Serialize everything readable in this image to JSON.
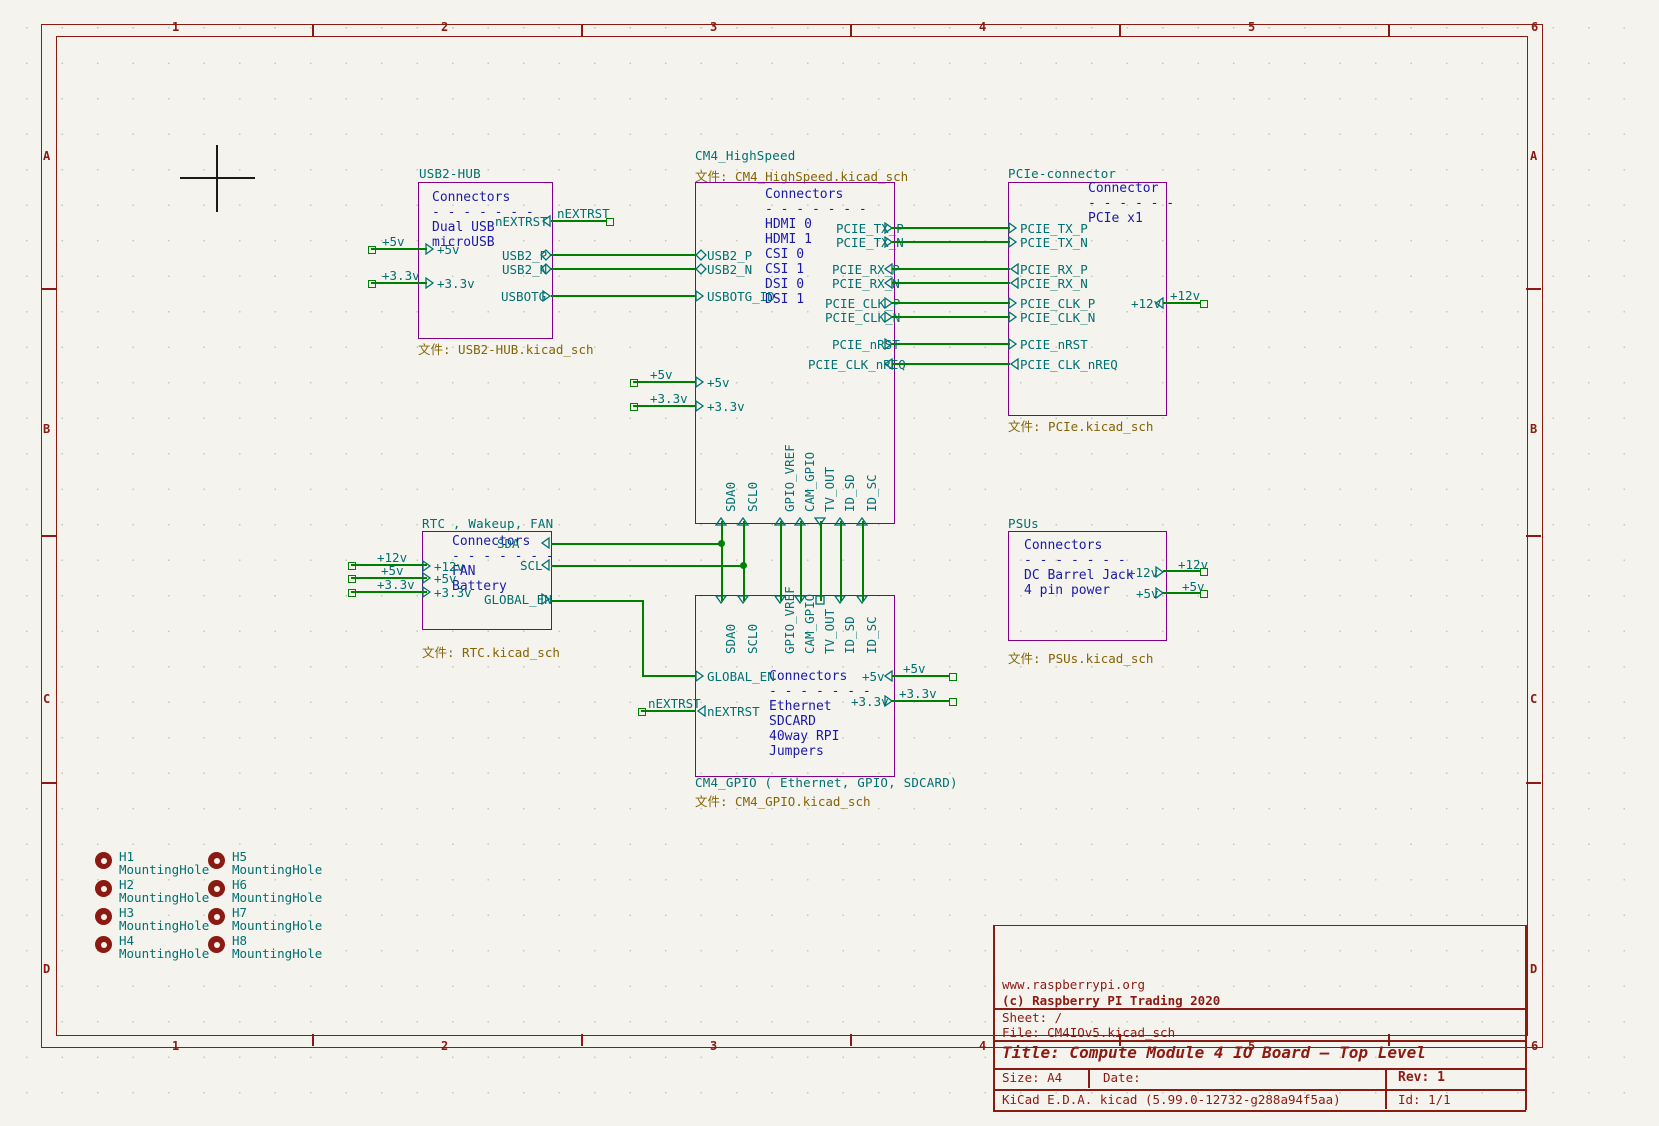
{
  "app": {
    "kind": "kicad-schematic-editor",
    "sheet_size": "A4"
  },
  "frame": {
    "column_labels": [
      "1",
      "2",
      "3",
      "4",
      "5",
      "6"
    ],
    "row_labels": [
      "A",
      "B",
      "C",
      "D"
    ]
  },
  "title_block": {
    "website": "www.raspberrypi.org",
    "copyright": "(c) Raspberry PI Trading 2020",
    "sheet_label": "Sheet: /",
    "file_label": "File: CM4IOv5.kicad_sch",
    "title": "Title: Compute Module 4 IO Board — Top Level",
    "size": "Size: A4",
    "date": "Date:",
    "rev": "Rev: 1",
    "tool": "KiCad E.D.A.  kicad (5.99.0-12732-g288a94f5aa)",
    "id": "Id: 1/1"
  },
  "sheets": [
    {
      "id": "usb2-hub",
      "name": "USB2-HUB",
      "file": "文件: USB2-HUB.kicad_sch",
      "body": "Connectors\n- - - - - - -\nDual USB\nmicroUSB",
      "pins_left": [
        "+5v",
        "+3.3v"
      ],
      "pins_right": [
        "nEXTRST",
        "USB2_P",
        "USB2_N",
        "USBOTG"
      ]
    },
    {
      "id": "cm4-highspeed",
      "name": "CM4_HighSpeed",
      "file": "文件: CM4_HighSpeed.kicad_sch",
      "body": "Connectors\n- - - - - - -\nHDMI 0\nHDMI 1\nCSI 0\nCSI 1\nDSI 0\nDSI 1",
      "pins_left": [
        "USB2_P",
        "USB2_N",
        "USBOTG_ID",
        "+5v",
        "+3.3v"
      ],
      "pins_right": [
        "PCIE_TX_P",
        "PCIE_TX_N",
        "PCIE_RX_P",
        "PCIE_RX_N",
        "PCIE_CLK_P",
        "PCIE_CLK_N",
        "PCIE_nRST",
        "PCIE_CLK_nREQ"
      ],
      "pins_bottom": [
        "SDA0",
        "SCL0",
        "GPIO_VREF",
        "CAM_GPIO",
        "TV_OUT",
        "ID_SD",
        "ID_SC"
      ]
    },
    {
      "id": "pcie-connector",
      "name": "PCIe-connector",
      "file": "文件: PCIe.kicad_sch",
      "body": "Connector\n- - - - - -\nPCIe x1",
      "pins_left": [
        "PCIE_TX_P",
        "PCIE_TX_N",
        "PCIE_RX_P",
        "PCIE_RX_N",
        "PCIE_CLK_P",
        "PCIE_CLK_N",
        "PCIE_nRST",
        "PCIE_CLK_nREQ"
      ],
      "pins_right": [
        "+12v"
      ]
    },
    {
      "id": "rtc-wakeup-fan",
      "name": "RTC , Wakeup, FAN",
      "file": "文件: RTC.kicad_sch",
      "body": "Connectors\n- - - - - - -\nFAN\nBattery",
      "pins_left": [
        "+12v",
        "+5v",
        "+3.3v"
      ],
      "pins_right": [
        "SDA",
        "SCL",
        "GLOBAL_EN"
      ]
    },
    {
      "id": "psus",
      "name": "PSUs",
      "file": "文件: PSUs.kicad_sch",
      "body": "Connectors\n- - - - - - -\nDC Barrel Jack\n4 pin power",
      "pins_right": [
        "+12v",
        "+5v"
      ]
    },
    {
      "id": "cm4-gpio",
      "name": "CM4_GPIO ( Ethernet, GPIO, SDCARD)",
      "file": "文件: CM4_GPIO.kicad_sch",
      "body": "Connectors\n- - - - - - -\nEthernet\nSDCARD\n40way RPI\nJumpers",
      "pins_top": [
        "SDA0",
        "SCL0",
        "GPIO_VREF",
        "CAM_GPIO",
        "TV_OUT",
        "ID_SD",
        "ID_SC"
      ],
      "pins_left": [
        "GLOBAL_EN",
        "nEXTRST"
      ],
      "pins_right": [
        "+5v",
        "+3.3v"
      ]
    }
  ],
  "net_labels": [
    {
      "text": "nEXTRST",
      "where": "usb2-hub-right"
    },
    {
      "text": "nEXTRST",
      "where": "cm4-gpio-left"
    },
    {
      "text": "+5v",
      "where": "usb2-hub-in"
    },
    {
      "text": "+3.3v",
      "where": "usb2-hub-in"
    },
    {
      "text": "+5v",
      "where": "cm4-hs-in"
    },
    {
      "text": "+3.3v",
      "where": "cm4-hs-in"
    },
    {
      "text": "+12v",
      "where": "rtc-in"
    },
    {
      "text": "+5v",
      "where": "rtc-in"
    },
    {
      "text": "+3.3v",
      "where": "rtc-in"
    },
    {
      "text": "+12v",
      "where": "pcie-out"
    },
    {
      "text": "+12v",
      "where": "psus-out"
    },
    {
      "text": "+5v",
      "where": "psus-out"
    },
    {
      "text": "+5v",
      "where": "cm4-gpio-out"
    },
    {
      "text": "+3.3v",
      "where": "cm4-gpio-out"
    }
  ],
  "mounting_holes": [
    {
      "ref": "H1",
      "value": "MountingHole"
    },
    {
      "ref": "H2",
      "value": "MountingHole"
    },
    {
      "ref": "H3",
      "value": "MountingHole"
    },
    {
      "ref": "H4",
      "value": "MountingHole"
    },
    {
      "ref": "H5",
      "value": "MountingHole"
    },
    {
      "ref": "H6",
      "value": "MountingHole"
    },
    {
      "ref": "H7",
      "value": "MountingHole"
    },
    {
      "ref": "H8",
      "value": "MountingHole"
    }
  ],
  "colors": {
    "background": "#f4f3ee",
    "frame": "#8b1a12",
    "sheet_border": "#82008c",
    "sheet_name": "#007070",
    "sheet_file": "#856404",
    "body_text": "#1a1aa8",
    "wire": "#008000",
    "pin_label": "#007070"
  }
}
